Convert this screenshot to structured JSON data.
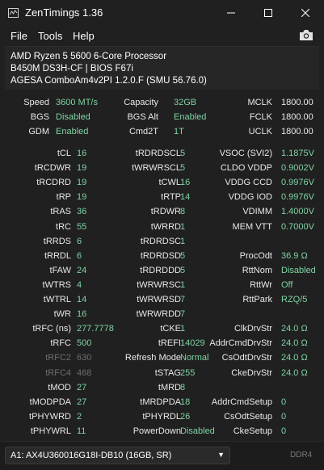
{
  "window": {
    "title": "ZenTimings 1.36"
  },
  "menu": [
    "File",
    "Tools",
    "Help"
  ],
  "info": {
    "cpu": "AMD Ryzen 5 5600 6-Core Processor",
    "board": "B450M DS3H-CF | BIOS F67i",
    "agesa": "AGESA ComboAm4v2PI 1.2.0.F (SMU 56.76.0)"
  },
  "top": [
    [
      {
        "l": "Speed",
        "v": "3600 MT/s"
      },
      {
        "l": "Capacity",
        "v": "32GB"
      },
      {
        "l": "MCLK",
        "v": "1800.00",
        "w": true
      }
    ],
    [
      {
        "l": "BGS",
        "v": "Disabled"
      },
      {
        "l": "BGS Alt",
        "v": "Enabled"
      },
      {
        "l": "FCLK",
        "v": "1800.00",
        "w": true
      }
    ],
    [
      {
        "l": "GDM",
        "v": "Enabled"
      },
      {
        "l": "Cmd2T",
        "v": "1T"
      },
      {
        "l": "UCLK",
        "v": "1800.00",
        "w": true
      }
    ]
  ],
  "rows": [
    [
      {
        "l": "tCL",
        "v": "16"
      },
      {
        "l": "tRDRDSCL",
        "v": "5"
      },
      {
        "l": "VSOC (SVI2)",
        "v": "1.1875V"
      }
    ],
    [
      {
        "l": "tRCDWR",
        "v": "19"
      },
      {
        "l": "tWRWRSCL",
        "v": "5"
      },
      {
        "l": "CLDO VDDP",
        "v": "0.9002V"
      }
    ],
    [
      {
        "l": "tRCDRD",
        "v": "19"
      },
      {
        "l": "tCWL",
        "v": "16"
      },
      {
        "l": "VDDG CCD",
        "v": "0.9976V"
      }
    ],
    [
      {
        "l": "tRP",
        "v": "19"
      },
      {
        "l": "tRTP",
        "v": "14"
      },
      {
        "l": "VDDG IOD",
        "v": "0.9976V"
      }
    ],
    [
      {
        "l": "tRAS",
        "v": "36"
      },
      {
        "l": "tRDWR",
        "v": "8"
      },
      {
        "l": "VDIMM",
        "v": "1.4000V"
      }
    ],
    [
      {
        "l": "tRC",
        "v": "55"
      },
      {
        "l": "tWRRD",
        "v": "1"
      },
      {
        "l": "MEM VTT",
        "v": "0.7000V"
      }
    ],
    [
      {
        "l": "tRRDS",
        "v": "6"
      },
      {
        "l": "tRDRDSC",
        "v": "1"
      },
      {
        "l": "",
        "v": ""
      }
    ],
    [
      {
        "l": "tRRDL",
        "v": "6"
      },
      {
        "l": "tRDRDSD",
        "v": "5"
      },
      {
        "l": "ProcOdt",
        "v": "36.9 Ω"
      }
    ],
    [
      {
        "l": "tFAW",
        "v": "24"
      },
      {
        "l": "tRDRDDD",
        "v": "5"
      },
      {
        "l": "RttNom",
        "v": "Disabled"
      }
    ],
    [
      {
        "l": "tWTRS",
        "v": "4"
      },
      {
        "l": "tWRWRSC",
        "v": "1"
      },
      {
        "l": "RttWr",
        "v": "Off"
      }
    ],
    [
      {
        "l": "tWTRL",
        "v": "14"
      },
      {
        "l": "tWRWRSD",
        "v": "7"
      },
      {
        "l": "RttPark",
        "v": "RZQ/5"
      }
    ],
    [
      {
        "l": "tWR",
        "v": "16"
      },
      {
        "l": "tWRWRDD",
        "v": "7"
      },
      {
        "l": "",
        "v": ""
      }
    ],
    [
      {
        "l": "tRFC (ns)",
        "v": "277.7778"
      },
      {
        "l": "tCKE",
        "v": "1"
      },
      {
        "l": "ClkDrvStr",
        "v": "24.0 Ω"
      }
    ],
    [
      {
        "l": "tRFC",
        "v": "500"
      },
      {
        "l": "tREFI",
        "v": "14029"
      },
      {
        "l": "AddrCmdDrvStr",
        "v": "24.0 Ω"
      }
    ],
    [
      {
        "l": "tRFC2",
        "v": "630",
        "d": true
      },
      {
        "l": "Refresh Mode",
        "v": "Normal"
      },
      {
        "l": "CsOdtDrvStr",
        "v": "24.0 Ω"
      }
    ],
    [
      {
        "l": "tRFC4",
        "v": "468",
        "d": true
      },
      {
        "l": "tSTAG",
        "v": "255"
      },
      {
        "l": "CkeDrvStr",
        "v": "24.0 Ω"
      }
    ],
    [
      {
        "l": "tMOD",
        "v": "27"
      },
      {
        "l": "tMRD",
        "v": "8"
      },
      {
        "l": "",
        "v": ""
      }
    ],
    [
      {
        "l": "tMODPDA",
        "v": "27"
      },
      {
        "l": "tMRDPDA",
        "v": "18"
      },
      {
        "l": "AddrCmdSetup",
        "v": "0"
      }
    ],
    [
      {
        "l": "tPHYWRD",
        "v": "2"
      },
      {
        "l": "tPHYRDL",
        "v": "26"
      },
      {
        "l": "CsOdtSetup",
        "v": "0"
      }
    ],
    [
      {
        "l": "tPHYWRL",
        "v": "11"
      },
      {
        "l": "PowerDown",
        "v": "Disabled"
      },
      {
        "l": "CkeSetup",
        "v": "0"
      }
    ]
  ],
  "footer": {
    "dimm": "A1: AX4U360016G18I-DB10 (16GB, SR)",
    "type": "DDR4"
  }
}
